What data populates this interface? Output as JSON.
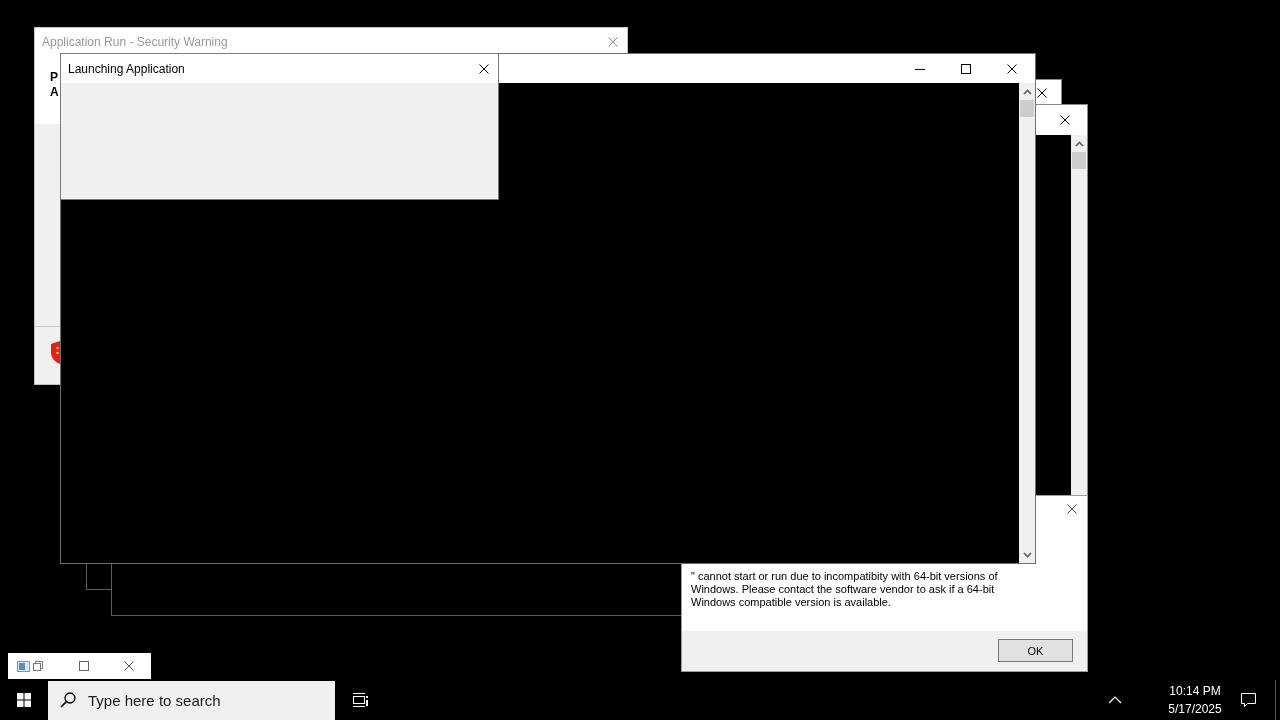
{
  "security_warning": {
    "title": "Application Run - Security Warning",
    "heading_lines": [
      "P",
      "A"
    ]
  },
  "launching_dialog": {
    "title": "Launching Application"
  },
  "error_dialog": {
    "message": "\" cannot start or run due to incompatibity with 64-bit versions of Windows. Please contact the software vendor to ask if a 64-bit Windows compatible version is available.",
    "buttons": [
      "OK"
    ]
  },
  "taskbar": {
    "search": {
      "placeholder": "Type here to search"
    },
    "clock": {
      "time": "10:14 PM",
      "date": "5/17/2025"
    }
  }
}
